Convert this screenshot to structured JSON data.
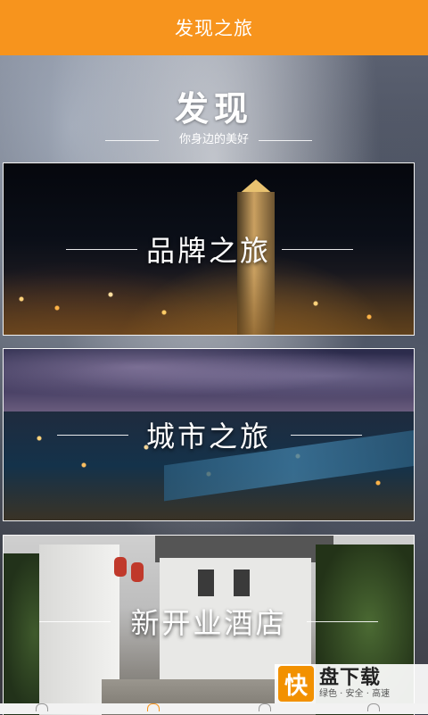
{
  "topbar": {
    "title": "发现之旅"
  },
  "hero": {
    "title": "发现",
    "subtitle": "你身边的美好"
  },
  "cards": [
    {
      "label": "品牌之旅"
    },
    {
      "label": "城市之旅"
    },
    {
      "label": "新开业酒店"
    }
  ],
  "watermark": {
    "logo_char": "快",
    "brand": "盘下载",
    "slogan": "绿色 · 安全 · 高速"
  },
  "colors": {
    "accent": "#f7941d",
    "text": "#ffffff"
  }
}
